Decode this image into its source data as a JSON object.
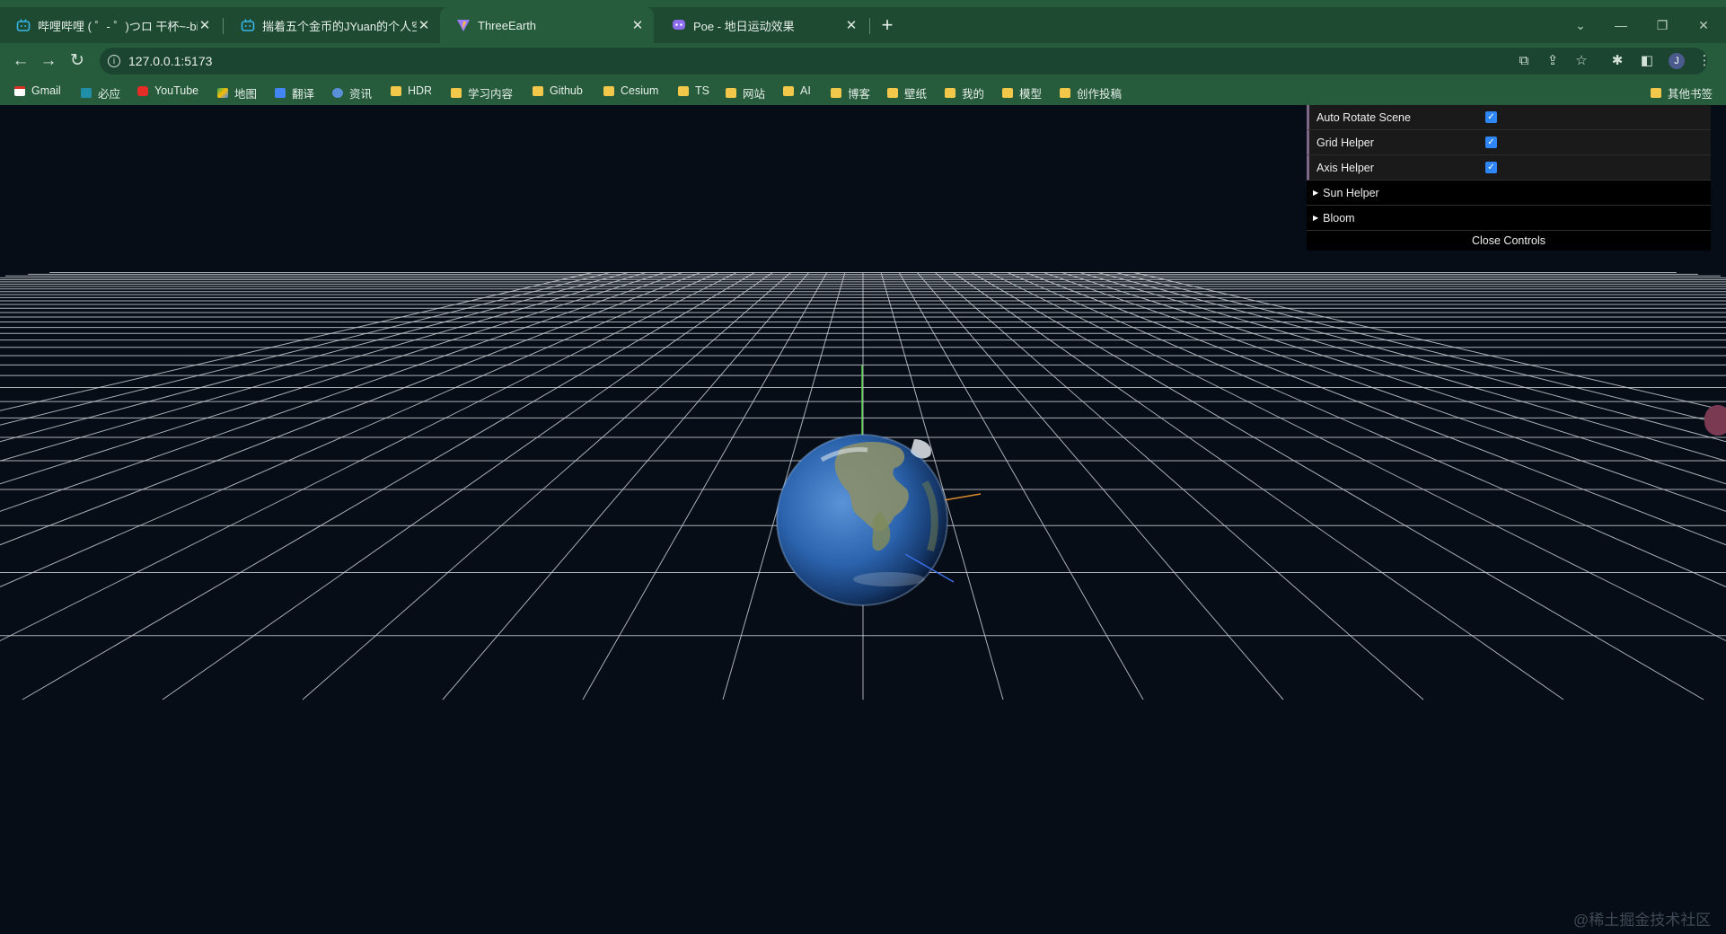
{
  "browser": {
    "tabs": [
      {
        "title": "哔哩哔哩 ( ゜- ゜)つロ 干杯~-bili",
        "icon": "bilibili-icon",
        "active": false
      },
      {
        "title": "揣着五个金币的JYuan的个人空间",
        "icon": "bilibili-icon",
        "active": false
      },
      {
        "title": "ThreeEarth",
        "icon": "vite-icon",
        "active": true
      },
      {
        "title": "Poe - 地日运动效果",
        "icon": "poe-icon",
        "active": false
      }
    ],
    "url": "127.0.0.1:5173",
    "profile_initial": "J",
    "bookmarks": [
      {
        "label": "Gmail",
        "icon": "gmail-icon"
      },
      {
        "label": "必应",
        "icon": "bing-icon"
      },
      {
        "label": "YouTube",
        "icon": "youtube-icon"
      },
      {
        "label": "地图",
        "icon": "maps-icon"
      },
      {
        "label": "翻译",
        "icon": "translate-icon"
      },
      {
        "label": "资讯",
        "icon": "news-icon"
      },
      {
        "label": "HDR",
        "icon": "folder-icon"
      },
      {
        "label": "学习内容",
        "icon": "folder-icon"
      },
      {
        "label": "Github",
        "icon": "folder-icon"
      },
      {
        "label": "Cesium",
        "icon": "folder-icon"
      },
      {
        "label": "TS",
        "icon": "folder-icon"
      },
      {
        "label": "网站",
        "icon": "folder-icon"
      },
      {
        "label": "AI",
        "icon": "folder-icon"
      },
      {
        "label": "博客",
        "icon": "folder-icon"
      },
      {
        "label": "壁纸",
        "icon": "folder-icon"
      },
      {
        "label": "我的",
        "icon": "folder-icon"
      },
      {
        "label": "模型",
        "icon": "folder-icon"
      },
      {
        "label": "创作投稿",
        "icon": "folder-icon"
      }
    ],
    "other_bookmarks": "其他书签"
  },
  "gui": {
    "auto_rotate": {
      "label": "Auto Rotate Scene",
      "checked": true
    },
    "grid_helper": {
      "label": "Grid Helper",
      "checked": true
    },
    "axis_helper": {
      "label": "Axis Helper",
      "checked": true
    },
    "sun_helper": {
      "label": "Sun Helper"
    },
    "bloom": {
      "label": "Bloom"
    },
    "close_controls": "Close Controls"
  },
  "watermark": "@稀土掘金技术社区",
  "colors": {
    "chrome": "#265b3c",
    "tabstrip": "#1d4a30",
    "scene_bg": "#070d16",
    "grid": "#c8ccd2",
    "checkbox": "#2f86f6",
    "gui_bg": "#1a1a1a"
  }
}
